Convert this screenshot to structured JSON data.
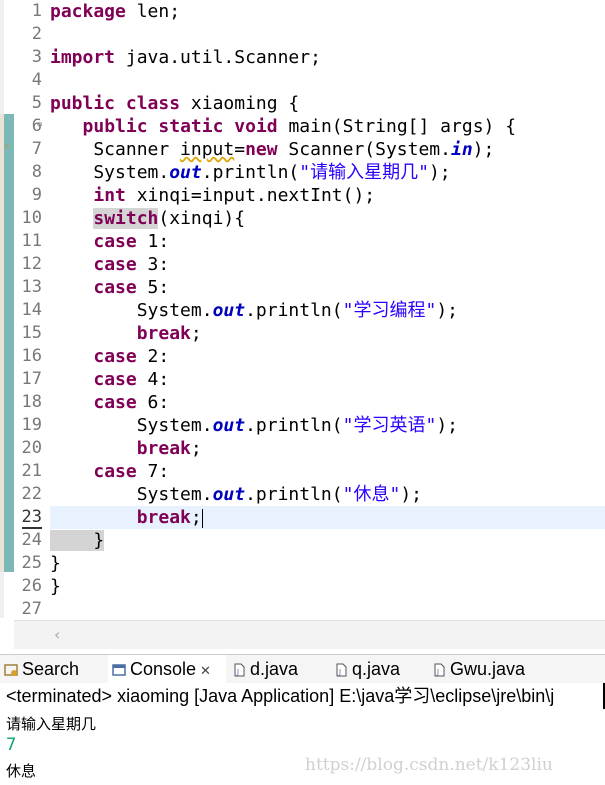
{
  "editor": {
    "line_numbers": [
      "1",
      "2",
      "3",
      "4",
      "5",
      "6",
      "7",
      "8",
      "9",
      "10",
      "11",
      "12",
      "13",
      "14",
      "15",
      "16",
      "17",
      "18",
      "19",
      "20",
      "21",
      "22",
      "23",
      "24",
      "25",
      "26",
      "27"
    ],
    "code": {
      "l1_kw": "package",
      "l1_rest": " len;",
      "l3_kw": "import",
      "l3_rest": " java.util.Scanner;",
      "l5_kw1": "public",
      "l5_kw2": "class",
      "l5_rest": " xiaoming {",
      "l6_indent": "   ",
      "l6_kw1": "public",
      "l6_kw2": "static",
      "l6_kw3": "void",
      "l6_rest": " main(String[] args) {",
      "l7_a": "    Scanner ",
      "l7_var": "input",
      "l7_eq": "=",
      "l7_kw": "new",
      "l7_b": " Scanner(System.",
      "l7_fld": "in",
      "l7_c": ");",
      "l8_a": "    System.",
      "l8_fld": "out",
      "l8_b": ".println(",
      "l8_str": "\"请输入星期几\"",
      "l8_c": ");",
      "l9_a": "    ",
      "l9_kw": "int",
      "l9_b": " xinqi=input.nextInt();",
      "l10_a": "    ",
      "l10_kw": "switch",
      "l10_b": "(xinqi){",
      "l11_a": "    ",
      "l11_kw": "case",
      "l11_b": " 1:",
      "l12_a": "    ",
      "l12_kw": "case",
      "l12_b": " 3:",
      "l13_a": "    ",
      "l13_kw": "case",
      "l13_b": " 5:",
      "l14_a": "        System.",
      "l14_fld": "out",
      "l14_b": ".println(",
      "l14_str": "\"学习编程\"",
      "l14_c": ");",
      "l15_a": "        ",
      "l15_kw": "break",
      "l15_b": ";",
      "l16_a": "    ",
      "l16_kw": "case",
      "l16_b": " 2:",
      "l17_a": "    ",
      "l17_kw": "case",
      "l17_b": " 4:",
      "l18_a": "    ",
      "l18_kw": "case",
      "l18_b": " 6:",
      "l19_a": "        System.",
      "l19_fld": "out",
      "l19_b": ".println(",
      "l19_str": "\"学习英语\"",
      "l19_c": ");",
      "l20_a": "        ",
      "l20_kw": "break",
      "l20_b": ";",
      "l21_a": "    ",
      "l21_kw": "case",
      "l21_b": " 7:",
      "l22_a": "        System.",
      "l22_fld": "out",
      "l22_b": ".println(",
      "l22_str": "\"休息\"",
      "l22_c": ");",
      "l23_a": "        ",
      "l23_kw": "break",
      "l23_b": ";",
      "l24": "    }",
      "l25": "}",
      "l26": "}"
    }
  },
  "tabs": [
    {
      "label": "Search",
      "icon": "search-icon"
    },
    {
      "label": "Console",
      "icon": "console-icon",
      "close": "✕"
    },
    {
      "label": "d.java",
      "icon": "java-file-icon"
    },
    {
      "label": "q.java",
      "icon": "java-file-icon"
    },
    {
      "label": "Gwu.java",
      "icon": "java-file-icon"
    }
  ],
  "console": {
    "header": "<terminated> xiaoming [Java Application] E:\\java学习\\eclipse\\jre\\bin\\j",
    "output1": "请输入星期几",
    "input": "7",
    "output2": "休息"
  },
  "watermark": "https://blog.csdn.net/k123liu",
  "colors": {
    "keyword": "#7f0055",
    "field": "#0000c0",
    "string": "#2a00ff",
    "console_input": "#0ea36e"
  }
}
